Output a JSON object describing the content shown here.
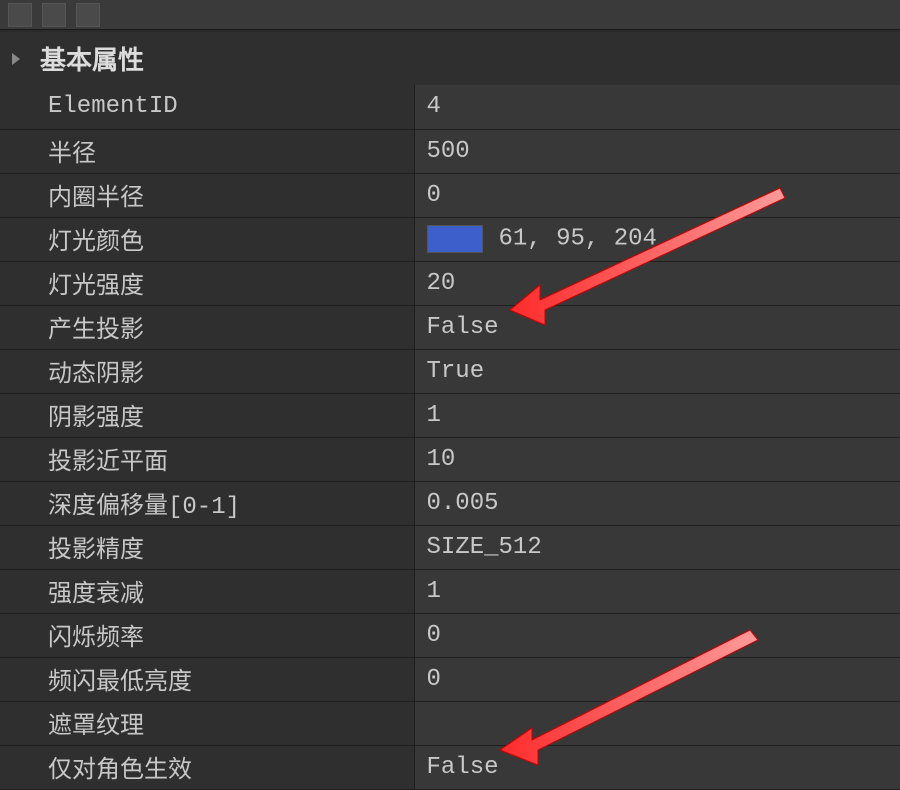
{
  "section": {
    "title": "基本属性"
  },
  "properties": [
    {
      "label": "ElementID",
      "value": "4",
      "type": "text"
    },
    {
      "label": "半径",
      "value": "500",
      "type": "text"
    },
    {
      "label": "内圈半径",
      "value": "0",
      "type": "text"
    },
    {
      "label": "灯光颜色",
      "value": "61, 95, 204",
      "type": "color",
      "swatch": "#3d5fcc"
    },
    {
      "label": "灯光强度",
      "value": "20",
      "type": "text"
    },
    {
      "label": "产生投影",
      "value": "False",
      "type": "bool"
    },
    {
      "label": "动态阴影",
      "value": "True",
      "type": "bool"
    },
    {
      "label": "阴影强度",
      "value": "1",
      "type": "text"
    },
    {
      "label": "投影近平面",
      "value": "10",
      "type": "text"
    },
    {
      "label": "深度偏移量[0-1]",
      "value": "0.005",
      "type": "text"
    },
    {
      "label": "投影精度",
      "value": "SIZE_512",
      "type": "enum"
    },
    {
      "label": "强度衰减",
      "value": "1",
      "type": "text"
    },
    {
      "label": "闪烁频率",
      "value": "0",
      "type": "text"
    },
    {
      "label": "频闪最低亮度",
      "value": "0",
      "type": "text"
    },
    {
      "label": "遮罩纹理",
      "value": "",
      "type": "text"
    },
    {
      "label": "仅对角色生效",
      "value": "False",
      "type": "bool"
    }
  ]
}
